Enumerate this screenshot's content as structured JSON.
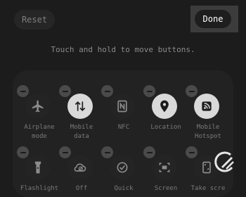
{
  "header": {
    "reset_label": "Reset",
    "done_label": "Done"
  },
  "hint": "Touch and hold to move buttons.",
  "tiles": [
    {
      "label": "Airplane\nmode",
      "icon": "airplane-icon",
      "active": false
    },
    {
      "label": "Mobile\ndata",
      "icon": "mobile-data-icon",
      "active": true
    },
    {
      "label": "NFC",
      "icon": "nfc-icon",
      "active": false
    },
    {
      "label": "Location",
      "icon": "location-icon",
      "active": true
    },
    {
      "label": "Mobile\nHotspot",
      "icon": "hotspot-icon",
      "active": true
    },
    {
      "label": "Flashlight",
      "icon": "flashlight-icon",
      "active": false
    },
    {
      "label": "Off",
      "icon": "cloud-off-icon",
      "active": false
    },
    {
      "label": "Quick",
      "icon": "quick-share-icon",
      "active": false
    },
    {
      "label": "Screen",
      "icon": "screen-icon",
      "active": false
    },
    {
      "label": "Take scre",
      "icon": "screenshot-icon",
      "active": false
    }
  ],
  "colors": {
    "background": "#1c1c1c",
    "panel": "#222222",
    "active_tile": "#d9d9d9",
    "inactive_icon": "#8c8c8c",
    "done_text": "#ffffff"
  }
}
